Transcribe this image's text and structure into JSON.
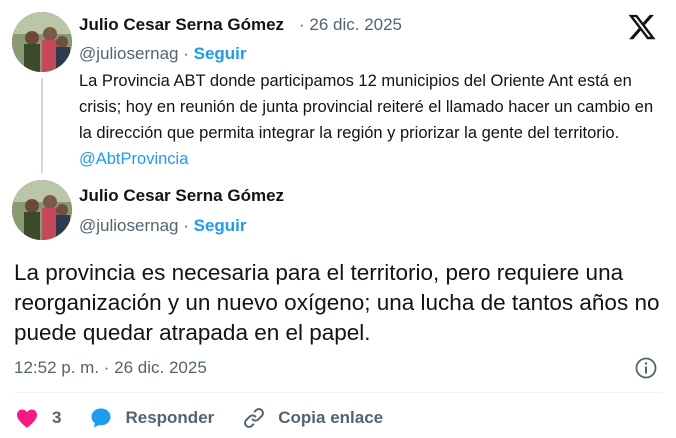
{
  "quoted_tweet": {
    "author_name": "Julio Cesar Serna Gómez",
    "date": "· 26 dic. 2025",
    "handle": "@juliosernag",
    "separator": "·",
    "follow_label": "Seguir",
    "text": "La Provincia ABT donde participamos 12 municipios del Oriente Ant está en crisis; hoy en reunión de junta provincial reiteré el llamado hacer un cambio en la dirección que permita integrar la región y priorizar la gente del territorio.",
    "mention": "@AbtProvincia"
  },
  "main_tweet": {
    "author_name": "Julio Cesar Serna Gómez",
    "handle": "@juliosernag",
    "separator": "·",
    "follow_label": "Seguir",
    "text": "La provincia es necesaria para el territorio, pero requiere una reorganización y un nuevo oxígeno;  una lucha de tantos años no puede quedar atrapada en el papel.",
    "timestamp": "12:52 p. m. · 26 dic. 2025"
  },
  "actions": {
    "like_count": "3",
    "reply_label": "Responder",
    "copy_link_label": "Copia enlace"
  },
  "icons": {
    "brand": "x-logo-icon",
    "info": "info-icon",
    "like": "heart-icon",
    "reply": "speech-bubble-icon",
    "copy": "link-icon"
  },
  "colors": {
    "accent": "#1d9bf0",
    "like": "#f91880",
    "secondary_text": "#536471",
    "primary_text": "#0f1419"
  }
}
